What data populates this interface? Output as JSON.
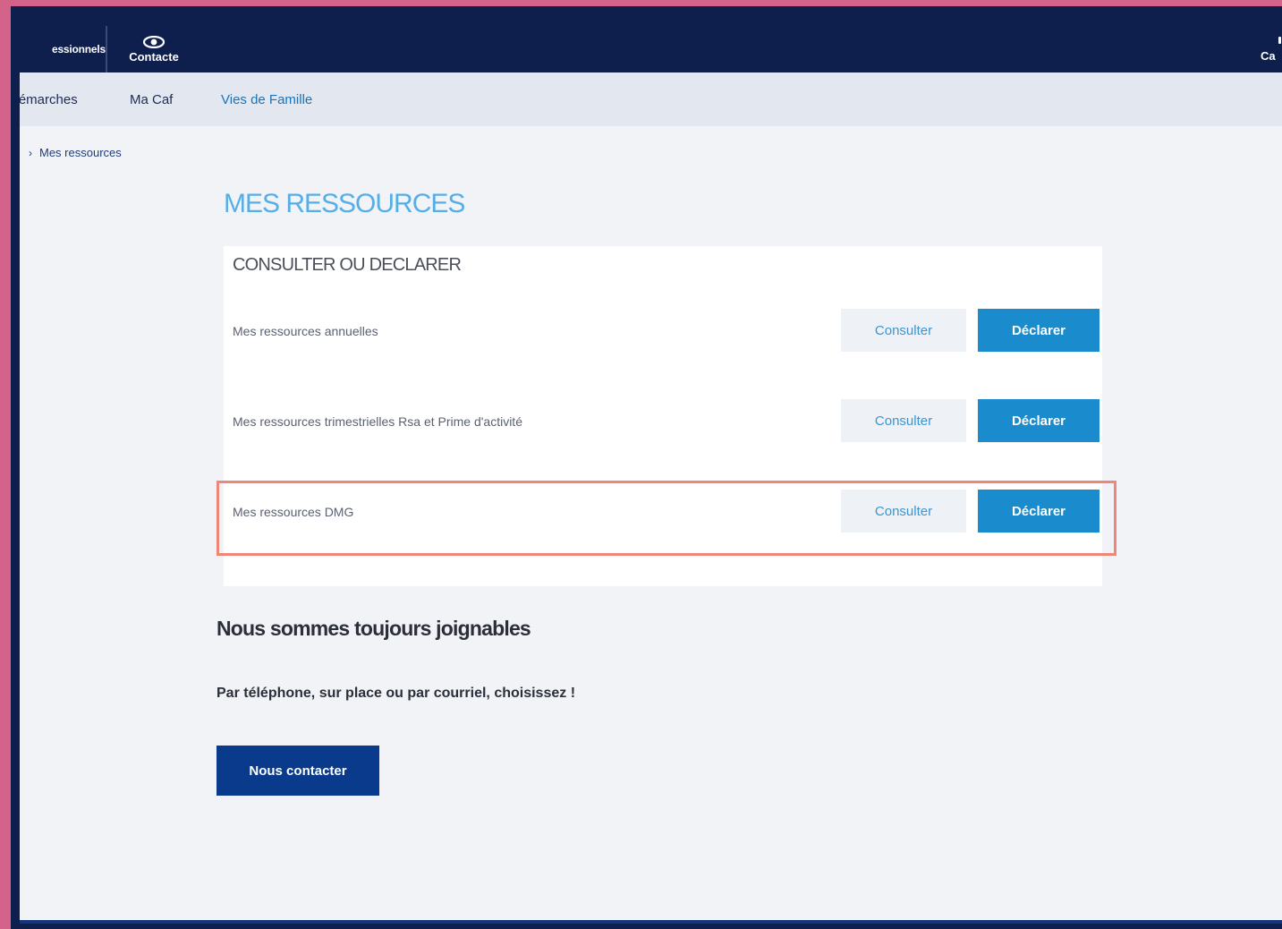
{
  "topbar": {
    "left_item": "essionnels",
    "contact_label": "Contacte",
    "right_item": "Ca"
  },
  "subnav": {
    "items": [
      {
        "label": "Démarches"
      },
      {
        "label": "Ma Caf"
      },
      {
        "label": "Vies de Famille"
      }
    ]
  },
  "breadcrumb": {
    "current": "Mes ressources"
  },
  "page": {
    "title": "MES RESSOURCES"
  },
  "card": {
    "title": "CONSULTER OU DECLARER",
    "rows": [
      {
        "label": "Mes ressources annuelles",
        "consult": "Consulter",
        "declare": "Déclarer"
      },
      {
        "label": "Mes ressources trimestrielles Rsa et Prime d'activité",
        "consult": "Consulter",
        "declare": "Déclarer"
      },
      {
        "label": "Mes ressources DMG",
        "consult": "Consulter",
        "declare": "Déclarer"
      }
    ]
  },
  "contact": {
    "heading": "Nous sommes toujours joignables",
    "subtext": "Par téléphone, sur place ou par courriel, choisissez !",
    "button": "Nous contacter"
  },
  "colors": {
    "frame": "#d4638a",
    "topbar": "#0e1f4d",
    "title_blue": "#56aee6",
    "declare_blue": "#1a8bcd",
    "contact_button": "#0a3a8c",
    "highlight": "#f08678"
  },
  "icons": {
    "contact": "eye-icon",
    "breadcrumb": "chevron-right-icon"
  }
}
